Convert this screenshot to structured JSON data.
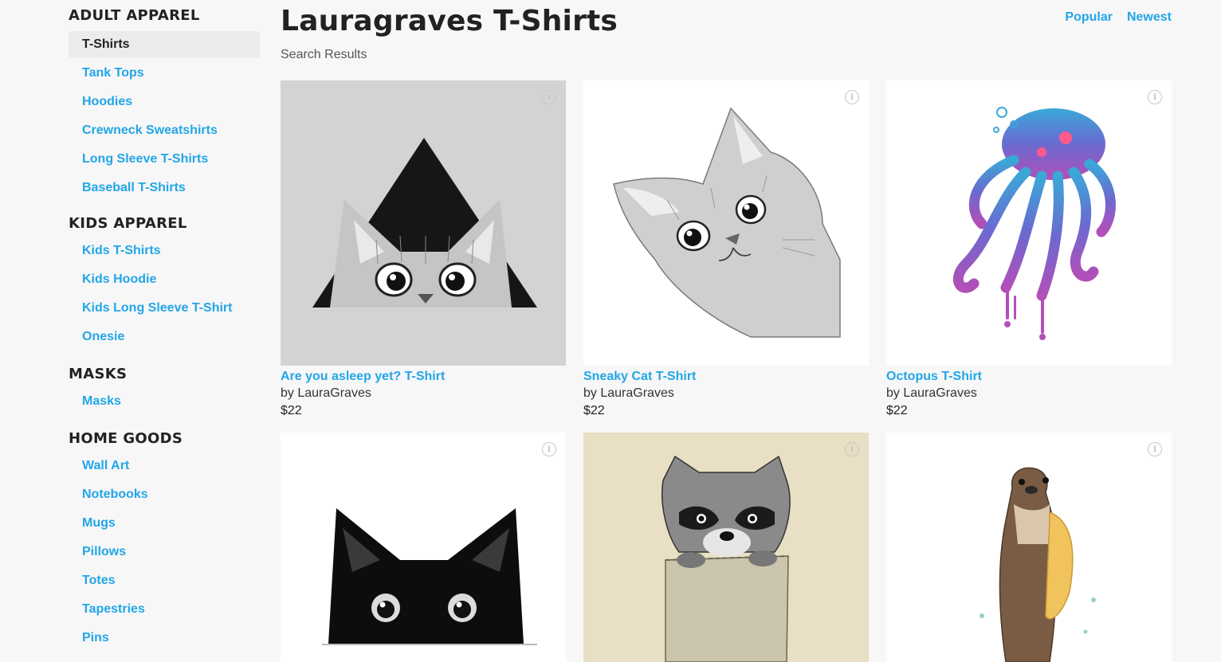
{
  "sidebar": {
    "sections": [
      {
        "heading": "ADULT APPAREL",
        "items": [
          "T-Shirts",
          "Tank Tops",
          "Hoodies",
          "Crewneck Sweatshirts",
          "Long Sleeve T-Shirts",
          "Baseball T-Shirts"
        ]
      },
      {
        "heading": "KIDS APPAREL",
        "items": [
          "Kids T-Shirts",
          "Kids Hoodie",
          "Kids Long Sleeve T-Shirt",
          "Onesie"
        ]
      },
      {
        "heading": "MASKS",
        "items": [
          "Masks"
        ]
      },
      {
        "heading": "HOME GOODS",
        "items": [
          "Wall Art",
          "Notebooks",
          "Mugs",
          "Pillows",
          "Totes",
          "Tapestries",
          "Pins"
        ]
      }
    ],
    "active_item": "T-Shirts"
  },
  "header": {
    "title": "Lauragraves T-Shirts",
    "subtitle": "Search Results",
    "sort": [
      "Popular",
      "Newest"
    ]
  },
  "products": [
    {
      "name": "Are you asleep yet? T-Shirt",
      "by": "by LauraGraves",
      "price": "$22",
      "art": "peeking-cat-triangle",
      "bg": "#d2d2d2"
    },
    {
      "name": "Sneaky Cat T-Shirt",
      "by": "by LauraGraves",
      "price": "$22",
      "art": "sneaky-cat",
      "bg": "#ffffff"
    },
    {
      "name": "Octopus T-Shirt",
      "by": "by LauraGraves",
      "price": "$22",
      "art": "watercolor-octopus",
      "bg": "#ffffff"
    },
    {
      "name": "",
      "by": "",
      "price": "",
      "art": "black-cat-peeking",
      "bg": "#ffffff"
    },
    {
      "name": "",
      "by": "",
      "price": "",
      "art": "raccoon-in-pocket",
      "bg": "#e8dfc4"
    },
    {
      "name": "",
      "by": "",
      "price": "",
      "art": "otter-with-towel",
      "bg": "#ffffff"
    }
  ],
  "icons": {
    "info": "info-icon",
    "info_glyph": "i"
  },
  "colors": {
    "link": "#22a6e8",
    "heading": "#222222",
    "page_bg": "#f7f7f7"
  }
}
